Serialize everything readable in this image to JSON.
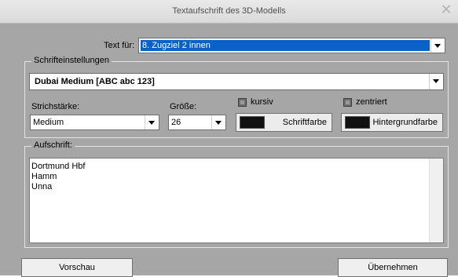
{
  "window": {
    "title": "Textaufschrift des 3D-Modells",
    "close_glyph": "✕"
  },
  "target": {
    "label": "Text für:",
    "selected": "8. Zugziel 2 innen"
  },
  "font_settings": {
    "group_label": "Schrifteinstellungen",
    "font_value": "Dubai Medium  [ABC abc 123]",
    "stroke_label": "Strichstärke:",
    "stroke_value": "Medium",
    "size_label": "Größe:",
    "size_value": "26",
    "italic_label": "kursiv",
    "centered_label": "zentriert",
    "font_color_label": "Schriftfarbe",
    "font_color": "#111111",
    "bg_color_label": "Hintergrundfarbe",
    "bg_color": "#111111"
  },
  "inscription": {
    "group_label": "Aufschrift:",
    "lines": [
      "Dortmund Hbf",
      "Hamm",
      "Unna"
    ]
  },
  "buttons": {
    "preview": "Vorschau",
    "apply": "Übernehmen"
  }
}
